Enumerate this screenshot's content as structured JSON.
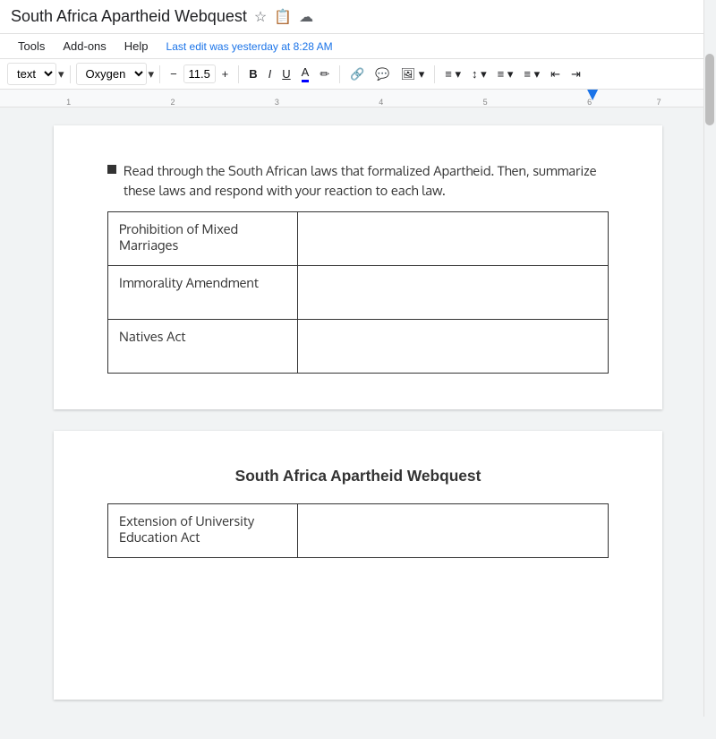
{
  "titleBar": {
    "title": "South Africa Apartheid Webquest",
    "starIcon": "☆",
    "folderIcon": "📁",
    "cloudIcon": "☁"
  },
  "menuBar": {
    "items": [
      "Tools",
      "Add-ons",
      "Help"
    ],
    "lastEdit": "Last edit was yesterday at 8:28 AM"
  },
  "toolbar": {
    "styleDropdown": "text",
    "fontDropdown": "Oxygen",
    "decreaseFont": "−",
    "fontSize": "11.5",
    "increaseFont": "+",
    "bold": "B",
    "italic": "I",
    "underline": "U",
    "textColor": "A",
    "highlight": "✏",
    "link": "🔗",
    "comment": "💬",
    "image": "🖼"
  },
  "page1": {
    "bulletText": "Read through the South African laws that formalized Apartheid. Then, summarize these laws and respond with your reaction to each law.",
    "tableRows": [
      {
        "law": "Prohibition of Mixed Marriages",
        "response": ""
      },
      {
        "law": "Immorality Amendment",
        "response": ""
      },
      {
        "law": "Natives Act",
        "response": ""
      }
    ]
  },
  "page2": {
    "title": "South Africa Apartheid Webquest",
    "tableRows": [
      {
        "law": "Extension of University Education Act",
        "response": ""
      }
    ]
  }
}
